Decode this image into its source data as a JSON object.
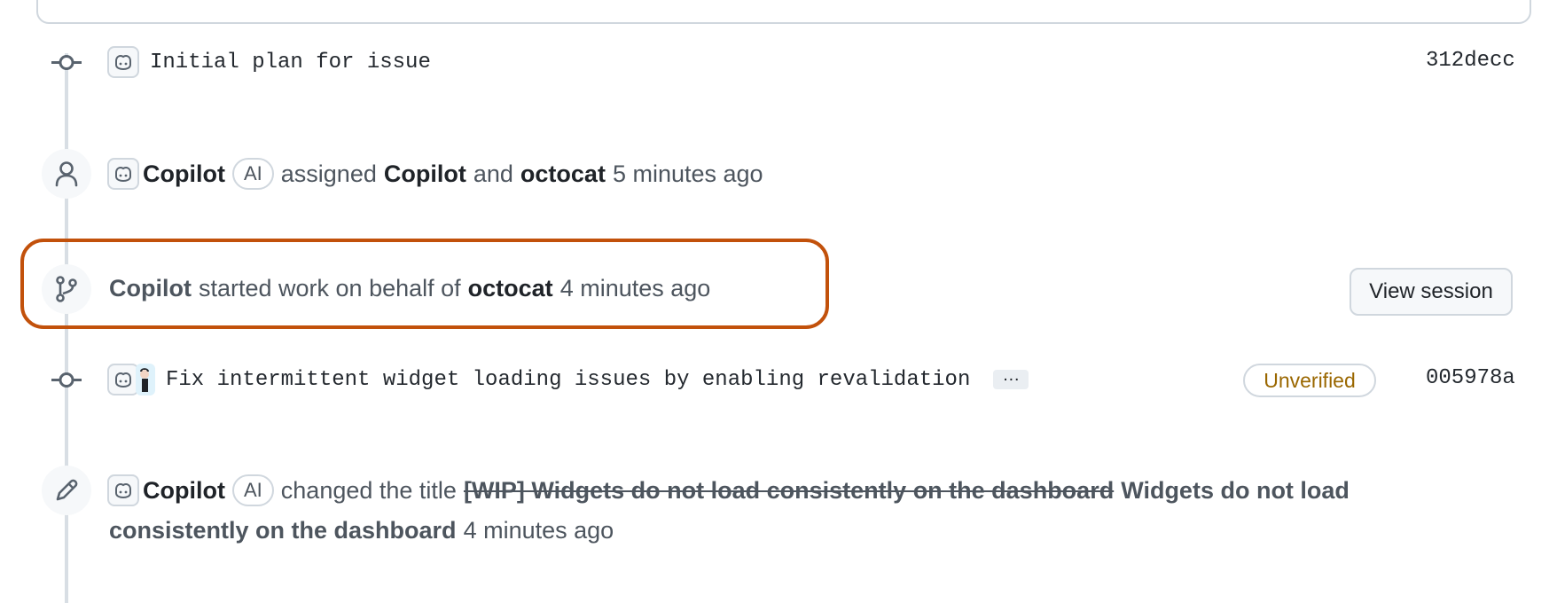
{
  "commit_initial": {
    "message": "Initial plan for issue",
    "sha": "312decc"
  },
  "event_assigned": {
    "actor": "Copilot",
    "actor_badge": "AI",
    "verb": "assigned",
    "assignee1": "Copilot",
    "conjunction": "and",
    "assignee2": "octocat",
    "time": "5 minutes ago"
  },
  "event_started": {
    "actor": "Copilot",
    "verb": "started work on behalf of",
    "target": "octocat",
    "time": "4 minutes ago",
    "button_label": "View session"
  },
  "commit_fix": {
    "message": "Fix intermittent widget loading issues by enabling revalidation",
    "ellipsis": "…",
    "status": "Unverified",
    "sha": "005978a"
  },
  "event_title_change": {
    "actor": "Copilot",
    "actor_badge": "AI",
    "verb": "changed the title",
    "old_title": "[WIP] Widgets do not load consistently on the dashboard",
    "new_title_line1": "Widgets do not load",
    "new_title_line2": "consistently on the dashboard",
    "time": "4 minutes ago"
  },
  "colors": {
    "highlight_border": "#c2510b",
    "unverified_text": "#9a6700",
    "timeline_line": "#d8dee4"
  }
}
